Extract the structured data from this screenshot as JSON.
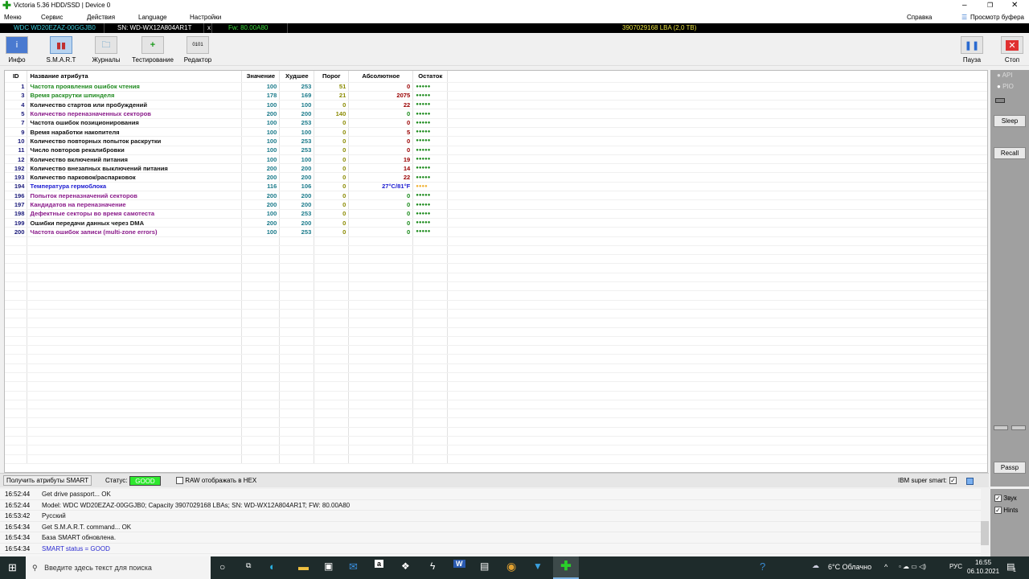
{
  "window": {
    "title": "Victoria 5.36 HDD/SSD | Device 0"
  },
  "menu": [
    "Меню",
    "Сервис",
    "Действия",
    "Language",
    "Настройки"
  ],
  "menu_right": {
    "help": "Справка",
    "buffer": "Просмотр буфера"
  },
  "device": {
    "model": "WDC WD20EZAZ-00GGJB0",
    "serial": "SN: WD-WX12A804AR1T",
    "close": "x",
    "fw": "Fw: 80.00A80",
    "lba": "3907029168 LBA (2,0 TB)"
  },
  "toolbar": [
    {
      "label": "Инфо",
      "icon": "info-icon"
    },
    {
      "label": "S.M.A.R.T",
      "icon": "smart-icon"
    },
    {
      "label": "Журналы",
      "icon": "logs-icon"
    },
    {
      "label": "Тестирование",
      "icon": "test-icon"
    },
    {
      "label": "Редактор",
      "icon": "editor-icon"
    }
  ],
  "toolbar_right": {
    "pause": "Пауза",
    "stop": "Стоп"
  },
  "table": {
    "headers": [
      "ID",
      "Название атрибута",
      "Значение",
      "Худшее",
      "Порог",
      "Абсолютное",
      "Остаток"
    ],
    "rows": [
      {
        "id": "1",
        "name": "Частота проявления ошибок чтения",
        "value": "100",
        "worst": "253",
        "thr": "51",
        "raw": "0",
        "rest": "●●●●●",
        "c": "#1f8a1f",
        "rc": "#9a0000"
      },
      {
        "id": "3",
        "name": "Время раскрутки шпинделя",
        "value": "178",
        "worst": "169",
        "thr": "21",
        "raw": "2075",
        "rest": "●●●●●",
        "c": "#1f8a1f",
        "rc": "#9a0000"
      },
      {
        "id": "4",
        "name": "Количество стартов или пробуждений",
        "value": "100",
        "worst": "100",
        "thr": "0",
        "raw": "22",
        "rest": "●●●●●",
        "c": "#111",
        "rc": "#9a0000"
      },
      {
        "id": "5",
        "name": "Количество переназначенных секторов",
        "value": "200",
        "worst": "200",
        "thr": "140",
        "raw": "0",
        "rest": "●●●●●",
        "c": "#8a1a8a",
        "rc": "#1a8a1a"
      },
      {
        "id": "7",
        "name": "Частота ошибок позиционирования",
        "value": "100",
        "worst": "253",
        "thr": "0",
        "raw": "0",
        "rest": "●●●●●",
        "c": "#111",
        "rc": "#9a0000"
      },
      {
        "id": "9",
        "name": "Время наработки накопителя",
        "value": "100",
        "worst": "100",
        "thr": "0",
        "raw": "5",
        "rest": "●●●●●",
        "c": "#111",
        "rc": "#9a0000"
      },
      {
        "id": "10",
        "name": "Количество повторных попыток раскрутки",
        "value": "100",
        "worst": "253",
        "thr": "0",
        "raw": "0",
        "rest": "●●●●●",
        "c": "#111",
        "rc": "#9a0000"
      },
      {
        "id": "11",
        "name": "Число повторов рекалибровки",
        "value": "100",
        "worst": "253",
        "thr": "0",
        "raw": "0",
        "rest": "●●●●●",
        "c": "#111",
        "rc": "#9a0000"
      },
      {
        "id": "12",
        "name": "Количество включений питания",
        "value": "100",
        "worst": "100",
        "thr": "0",
        "raw": "19",
        "rest": "●●●●●",
        "c": "#111",
        "rc": "#9a0000"
      },
      {
        "id": "192",
        "name": "Количество внезапных выключений питания",
        "value": "200",
        "worst": "200",
        "thr": "0",
        "raw": "14",
        "rest": "●●●●●",
        "c": "#111",
        "rc": "#9a0000"
      },
      {
        "id": "193",
        "name": "Количество парковок/распарковок",
        "value": "200",
        "worst": "200",
        "thr": "0",
        "raw": "22",
        "rest": "●●●●●",
        "c": "#111",
        "rc": "#9a0000"
      },
      {
        "id": "194",
        "name": "Температура гермоблока",
        "value": "116",
        "worst": "106",
        "thr": "0",
        "raw": "27°C/81°F",
        "rest": "●●●●",
        "c": "#1a1ad0",
        "rc": "#1a1ad0",
        "dc": "#f0b030"
      },
      {
        "id": "196",
        "name": "Попыток переназначений секторов",
        "value": "200",
        "worst": "200",
        "thr": "0",
        "raw": "0",
        "rest": "●●●●●",
        "c": "#8a1a8a",
        "rc": "#1a8a1a"
      },
      {
        "id": "197",
        "name": "Кандидатов на переназначение",
        "value": "200",
        "worst": "200",
        "thr": "0",
        "raw": "0",
        "rest": "●●●●●",
        "c": "#8a1a8a",
        "rc": "#1a8a1a"
      },
      {
        "id": "198",
        "name": "Дефектные секторы во время самотеста",
        "value": "100",
        "worst": "253",
        "thr": "0",
        "raw": "0",
        "rest": "●●●●●",
        "c": "#8a1a8a",
        "rc": "#1a8a1a"
      },
      {
        "id": "199",
        "name": "Ошибки передачи данных через DMA",
        "value": "200",
        "worst": "200",
        "thr": "0",
        "raw": "0",
        "rest": "●●●●●",
        "c": "#111",
        "rc": "#1a8a1a"
      },
      {
        "id": "200",
        "name": "Частота ошибок записи (multi-zone errors)",
        "value": "100",
        "worst": "253",
        "thr": "0",
        "raw": "0",
        "rest": "●●●●●",
        "c": "#8a1a8a",
        "rc": "#1a8a1a"
      }
    ]
  },
  "right_panel": {
    "api": "API",
    "pio": "PIO",
    "sleep": "Sleep",
    "recall": "Recall",
    "passp": "Passp"
  },
  "status_bar": {
    "get_smart": "Получить атрибуты SMART",
    "status_label": "Статус:",
    "status_value": "GOOD",
    "raw_hex": "RAW отображать в HEX",
    "ibm": "IBM super smart:"
  },
  "log": [
    {
      "t": "16:52:44",
      "m": "Get drive passport... OK"
    },
    {
      "t": "16:52:44",
      "m": "Model: WDC WD20EZAZ-00GGJB0; Capacity 3907029168 LBAs; SN: WD-WX12A804AR1T; FW: 80.00A80"
    },
    {
      "t": "16:53:42",
      "m": "Русский"
    },
    {
      "t": "16:54:34",
      "m": "Get S.M.A.R.T. command... OK"
    },
    {
      "t": "16:54:34",
      "m": "База SMART обновлена."
    },
    {
      "t": "16:54:34",
      "m": "SMART status = GOOD",
      "blue": true
    }
  ],
  "log_side": {
    "sound": "Звук",
    "hints": "Hints"
  },
  "taskbar": {
    "search": "Введите здесь текст для поиска",
    "weather": "6°C  Облачно",
    "lang": "РУС",
    "time": "16:55",
    "date": "06.10.2021",
    "notif": "1"
  }
}
